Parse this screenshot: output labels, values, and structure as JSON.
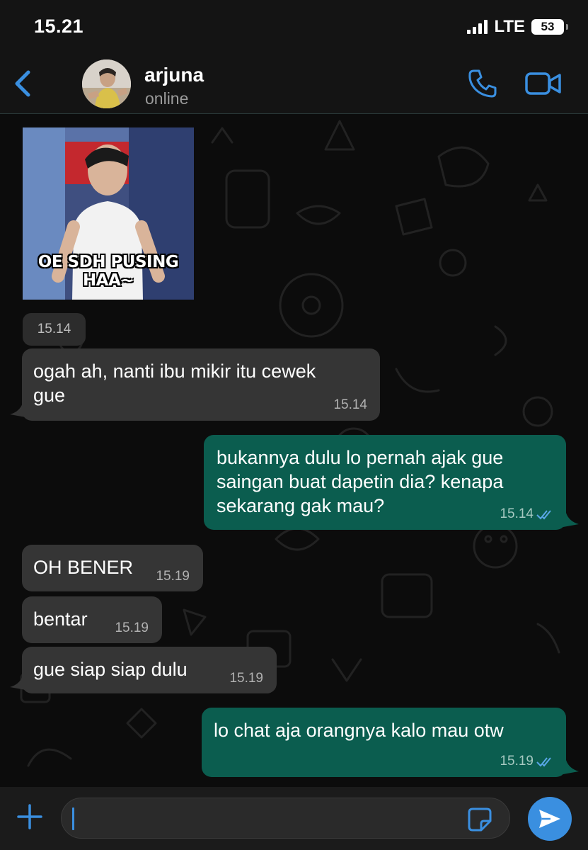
{
  "status_bar": {
    "time": "15.21",
    "network": "LTE",
    "battery": "53"
  },
  "header": {
    "contact_name": "arjuna",
    "contact_status": "online"
  },
  "sticker": {
    "caption": "OE SDH PUSING HAA~",
    "time": "15.14"
  },
  "messages": [
    {
      "direction": "in",
      "lines": [
        "ogah ah, nanti ibu mikir itu cewek",
        "gue"
      ],
      "time": "15.14"
    },
    {
      "direction": "out",
      "lines": [
        "bukannya dulu lo pernah ajak gue",
        "saingan buat dapetin dia? kenapa",
        "sekarang gak mau?"
      ],
      "time": "15.14",
      "read": true
    },
    {
      "direction": "in",
      "lines": [
        "OH BENER"
      ],
      "time": "15.19"
    },
    {
      "direction": "in",
      "lines": [
        "bentar"
      ],
      "time": "15.19"
    },
    {
      "direction": "in",
      "lines": [
        "gue siap siap dulu"
      ],
      "time": "15.19"
    },
    {
      "direction": "out",
      "lines": [
        "lo chat aja orangnya kalo mau otw"
      ],
      "time": "15.19",
      "read": true
    }
  ],
  "input": {
    "value": "",
    "placeholder": ""
  },
  "colors": {
    "accent": "#3a8fe0",
    "incoming_bubble": "#353535",
    "outgoing_bubble": "#0b5d4f",
    "background": "#0c0c0c"
  },
  "icons": [
    "chevron-left-icon",
    "phone-icon",
    "video-camera-icon",
    "plus-icon",
    "sticker-icon",
    "send-icon",
    "double-check-icon"
  ]
}
